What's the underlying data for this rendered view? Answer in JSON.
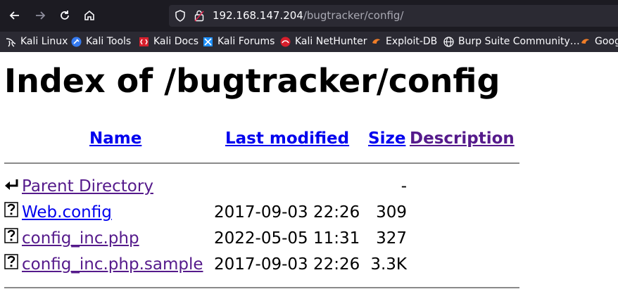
{
  "browser": {
    "url_host": "192.168.147.204",
    "url_path": "/bugtracker/config/",
    "bookmarks": [
      {
        "label": "Kali Linux",
        "icon": "kali-dragon-icon"
      },
      {
        "label": "Kali Tools",
        "icon": "kali-tools-icon"
      },
      {
        "label": "Kali Docs",
        "icon": "kali-docs-icon"
      },
      {
        "label": "Kali Forums",
        "icon": "kali-forums-icon"
      },
      {
        "label": "Kali NetHunter",
        "icon": "kali-nethunter-icon"
      },
      {
        "label": "Exploit-DB",
        "icon": "exploit-db-icon"
      },
      {
        "label": "Burp Suite Community…",
        "icon": "globe-icon"
      },
      {
        "label": "Goog",
        "icon": "google-icon"
      }
    ]
  },
  "page": {
    "title": "Index of /bugtracker/config",
    "columns": {
      "name": "Name",
      "last_modified": "Last modified",
      "size": "Size",
      "description": "Description"
    },
    "rows": [
      {
        "name": "Parent Directory",
        "date": "",
        "size": "-",
        "icon": "back-arrow-icon"
      },
      {
        "name": "Web.config",
        "date": "2017-09-03 22:26",
        "size": "309",
        "icon": "unknown-file-icon"
      },
      {
        "name": "config_inc.php",
        "date": "2022-05-05 11:31",
        "size": "327",
        "icon": "unknown-file-icon"
      },
      {
        "name": "config_inc.php.sample",
        "date": "2017-09-03 22:26",
        "size": "3.3K",
        "icon": "unknown-file-icon"
      }
    ]
  }
}
